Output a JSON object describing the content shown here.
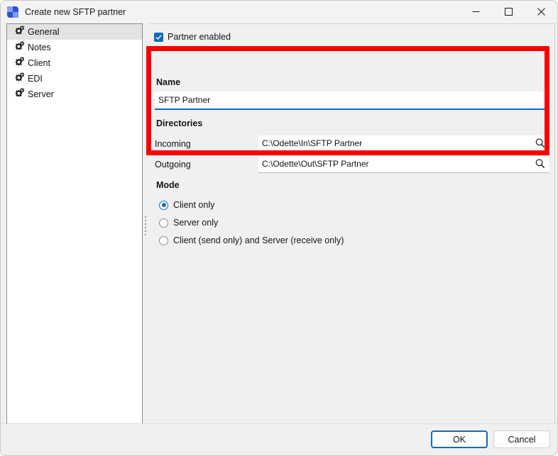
{
  "window": {
    "title": "Create new SFTP partner",
    "app_icon": "app-logo-icon",
    "caption": {
      "minimize": "minimize-icon",
      "maximize": "maximize-icon",
      "close": "close-icon"
    }
  },
  "sidebar": {
    "items": [
      {
        "label": "General",
        "icon": "gear-icon",
        "selected": true
      },
      {
        "label": "Notes",
        "icon": "gear-icon",
        "selected": false
      },
      {
        "label": "Client",
        "icon": "gear-icon",
        "selected": false
      },
      {
        "label": "EDI",
        "icon": "gear-icon",
        "selected": false
      },
      {
        "label": "Server",
        "icon": "gear-icon",
        "selected": false
      }
    ]
  },
  "panel": {
    "partner_enabled": {
      "label": "Partner enabled",
      "checked": true
    },
    "name_section": {
      "heading": "Name",
      "value": "SFTP Partner"
    },
    "directories_section": {
      "heading": "Directories",
      "incoming": {
        "label": "Incoming",
        "value": "C:\\Odette\\In\\SFTP Partner",
        "browse_icon": "search-icon"
      },
      "outgoing": {
        "label": "Outgoing",
        "value": "C:\\Odette\\Out\\SFTP Partner",
        "browse_icon": "search-icon"
      }
    },
    "mode_section": {
      "heading": "Mode",
      "options": [
        {
          "label": "Client only",
          "selected": true
        },
        {
          "label": "Server only",
          "selected": false
        },
        {
          "label": "Client (send only) and Server (receive only)",
          "selected": false
        }
      ]
    }
  },
  "footer": {
    "ok_label": "OK",
    "cancel_label": "Cancel"
  },
  "annotation": {
    "color": "#fa0000",
    "name": "highlight-rectangle"
  }
}
